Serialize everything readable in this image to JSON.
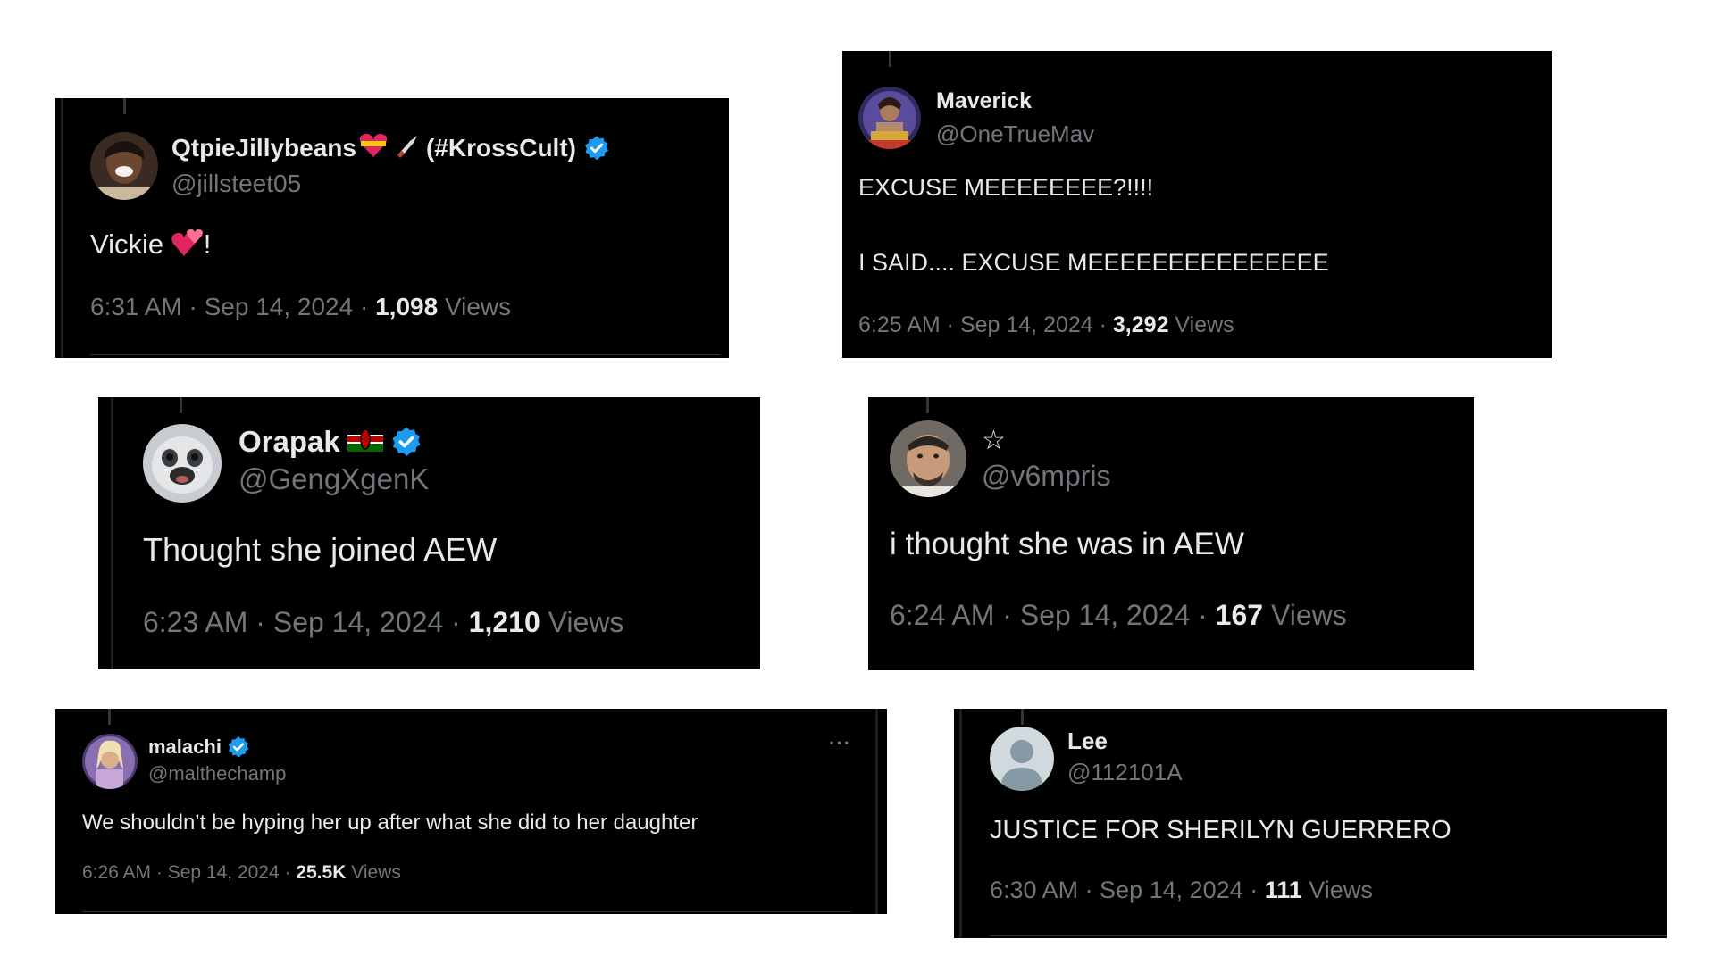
{
  "accent_color": "#1d9bf0",
  "tweets": {
    "qtpie": {
      "name": "QtpieJillybeans",
      "name_suffix": "(#KrossCult)",
      "handle": "@jillsteet05",
      "text": "Vickie",
      "text_end": "!",
      "time": "6:31 AM · Sep 14, 2024 · ",
      "views_count": "1,098",
      "views_label": " Views",
      "verified": true
    },
    "maverick": {
      "name": "Maverick",
      "handle": "@OneTrueMav",
      "line1": "EXCUSE MEEEEEEEE?!!!!",
      "line2": "I SAID.... EXCUSE MEEEEEEEEEEEEEEE",
      "time": "6:25 AM · Sep 14, 2024 · ",
      "views_count": "3,292",
      "views_label": " Views"
    },
    "orapak": {
      "name": "Orapak",
      "handle": "@GengXgenK",
      "text": "Thought she joined AEW",
      "time": "6:23 AM · Sep 14, 2024 · ",
      "views_count": "1,210",
      "views_label": " Views",
      "verified": true,
      "flag": "kenya-flag-icon"
    },
    "v6mpris": {
      "name": "☆",
      "handle": "@v6mpris",
      "text": "i thought she was in AEW",
      "time": "6:24 AM · Sep 14, 2024 · ",
      "views_count": "167",
      "views_label": " Views"
    },
    "malachi": {
      "name": "malachi",
      "handle": "@malthechamp",
      "text": "We shouldn’t be hyping her up after what she did to her daughter",
      "time": "6:26 AM · Sep 14, 2024 · ",
      "views_count": "25.5K",
      "views_label": " Views",
      "verified": true,
      "more": "···"
    },
    "lee": {
      "name": "Lee",
      "handle": "@112101A",
      "text": "JUSTICE FOR SHERILYN GUERRERO",
      "time": "6:30 AM · Sep 14, 2024 · ",
      "views_count": "111",
      "views_label": " Views"
    }
  }
}
